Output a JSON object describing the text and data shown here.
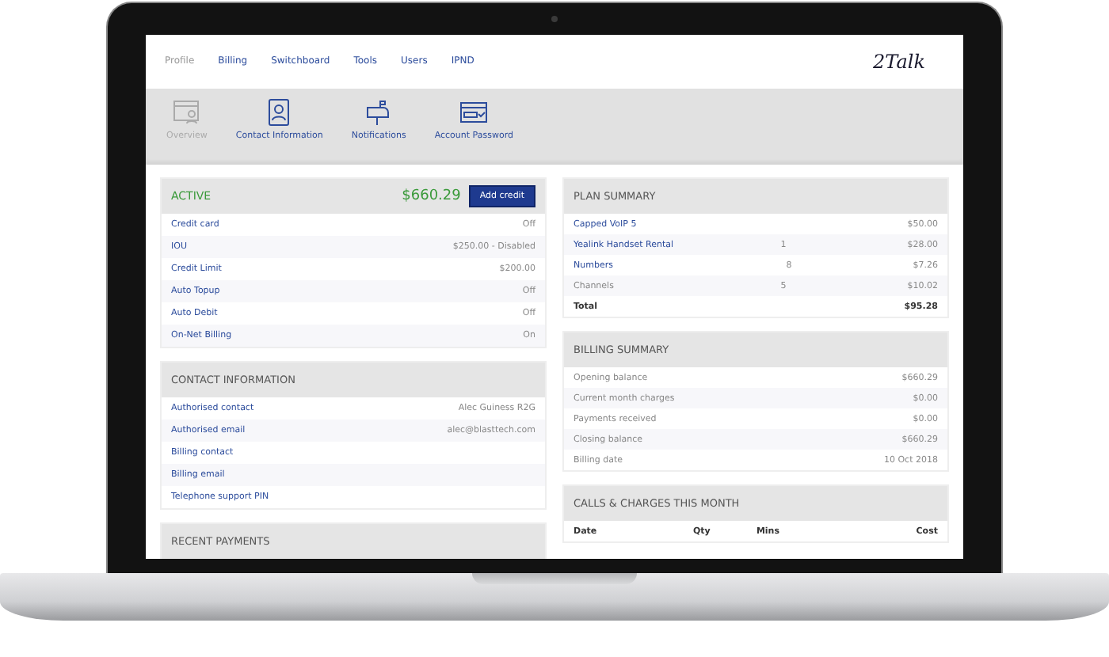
{
  "nav": {
    "tabs": [
      {
        "label": "Profile",
        "selected": true
      },
      {
        "label": "Billing",
        "selected": false
      },
      {
        "label": "Switchboard",
        "selected": false
      },
      {
        "label": "Tools",
        "selected": false
      },
      {
        "label": "Users",
        "selected": false
      },
      {
        "label": "IPND",
        "selected": false
      }
    ],
    "logo": "2Talk"
  },
  "subnav": [
    {
      "label": "Overview",
      "kind": "overview",
      "selected": true
    },
    {
      "label": "Contact Information",
      "kind": "contact",
      "selected": false
    },
    {
      "label": "Notifications",
      "kind": "mailbox",
      "selected": false
    },
    {
      "label": "Account Password",
      "kind": "password",
      "selected": false
    }
  ],
  "account": {
    "status": "ACTIVE",
    "balance": "$660.29",
    "button": "Add credit",
    "rows": [
      {
        "label": "Credit card",
        "value": "Off"
      },
      {
        "label": "IOU",
        "value": "$250.00 - Disabled"
      },
      {
        "label": "Credit Limit",
        "value": "$200.00"
      },
      {
        "label": "Auto Topup",
        "value": "Off"
      },
      {
        "label": "Auto Debit",
        "value": "Off"
      },
      {
        "label": "On-Net Billing",
        "value": "On"
      }
    ]
  },
  "contact": {
    "title": "CONTACT INFORMATION",
    "rows": [
      {
        "label": "Authorised contact",
        "value": "Alec Guiness R2G"
      },
      {
        "label": "Authorised email",
        "value": "alec@blasttech.com"
      },
      {
        "label": "Billing contact"
      },
      {
        "label": "Billing email"
      },
      {
        "label": "Telephone support PIN"
      }
    ]
  },
  "recent_payments": {
    "title": "RECENT PAYMENTS"
  },
  "plan": {
    "title": "PLAN SUMMARY",
    "rows": [
      {
        "kind": "link",
        "label": "Capped VoIP 5",
        "value": "$50.00"
      },
      {
        "kind": "link",
        "label": "Yealink Handset Rental",
        "qty": "1",
        "value": "$28.00"
      },
      {
        "kind": "link",
        "label": "Numbers",
        "qty": "8",
        "value": "$7.26"
      },
      {
        "kind": "plain",
        "label": "Channels",
        "qty": "5",
        "value": "$10.02"
      },
      {
        "kind": "total",
        "label": "Total",
        "value": "$95.28"
      }
    ]
  },
  "billing": {
    "title": "BILLING SUMMARY",
    "rows": [
      {
        "label": "Opening balance",
        "value": "$660.29"
      },
      {
        "label": "Current month charges",
        "value": "$0.00"
      },
      {
        "label": "Payments received",
        "value": "$0.00"
      },
      {
        "label": "Closing balance",
        "value": "$660.29"
      },
      {
        "label": "Billing date",
        "value": "10 Oct 2018"
      }
    ]
  },
  "calls": {
    "title": "CALLS & CHARGES THIS MONTH",
    "columns": [
      "Date",
      "Qty",
      "Mins",
      "Cost"
    ]
  }
}
